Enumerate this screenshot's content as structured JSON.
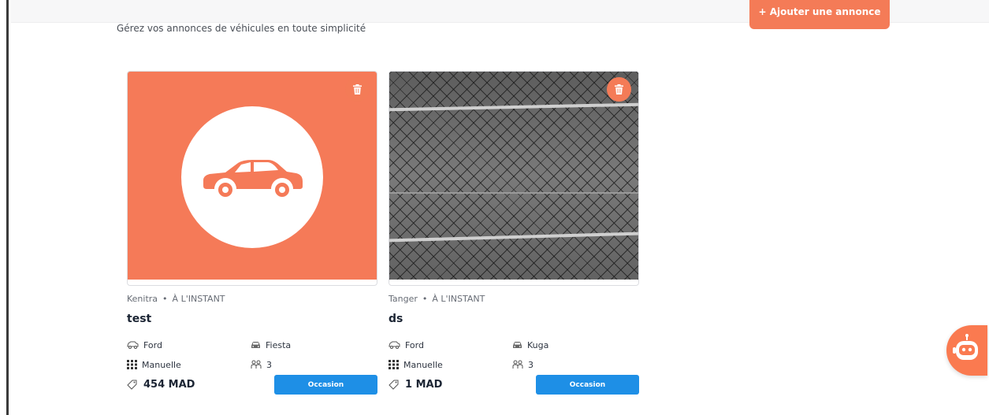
{
  "header": {
    "subtitle": "Gérez vos annonces de véhicules en toute simplicité",
    "add_button": "+ Ajouter une annonce"
  },
  "listings": [
    {
      "city": "Kenitra",
      "time": "À L'INSTANT",
      "title": "test",
      "brand": "Ford",
      "model": "Fiesta",
      "transmission": "Manuelle",
      "seats": "3",
      "price": "454 MAD",
      "condition": "Occasion",
      "image": "car-placeholder"
    },
    {
      "city": "Tanger",
      "time": "À L'INSTANT",
      "title": "ds",
      "brand": "Ford",
      "model": "Kuga",
      "transmission": "Manuelle",
      "seats": "3",
      "price": "1 MAD",
      "condition": "Occasion",
      "image": "chain-link-fence-photo"
    }
  ],
  "colors": {
    "accent": "#f47b57",
    "badge": "#1e8fe6",
    "text": "#1b2433"
  },
  "icons": [
    "trash-icon",
    "car-icon",
    "car-front-icon",
    "gearbox-icon",
    "seats-icon",
    "tag-icon",
    "chatbot-icon"
  ]
}
